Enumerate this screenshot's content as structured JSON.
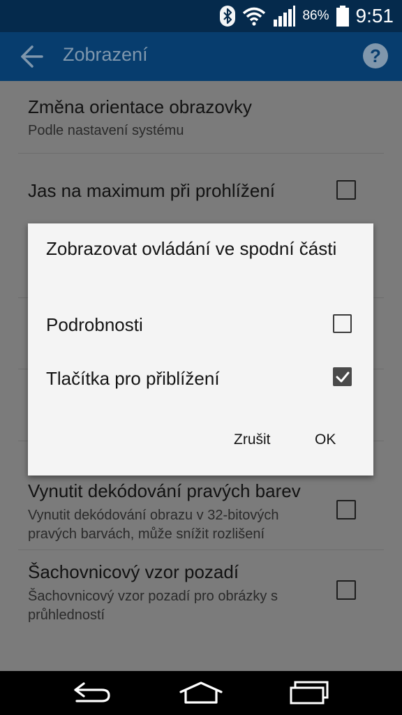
{
  "status_bar": {
    "battery_percent": "86%",
    "time": "9:51",
    "icons": [
      "bluetooth-icon",
      "wifi-icon",
      "signal-icon",
      "battery-icon"
    ]
  },
  "app_bar": {
    "title": "Zobrazení",
    "back_icon": "arrow-back-icon",
    "help_icon": "help-icon",
    "help_glyph": "?"
  },
  "preferences": [
    {
      "title": "Změna orientace obrazovky",
      "summary": "Podle nastavení systému"
    },
    {
      "title": "Jas na maximum při prohlížení",
      "checked": false
    },
    {
      "title": "Vynutit dekódování pravých barev",
      "summary_line1": "Vynutit dekódování obrazu v 32-bitových",
      "summary_line2": "pravých barvách, může snížit rozlišení",
      "checked": false
    },
    {
      "title": "Šachovnicový vzor pozadí",
      "summary_line1": "Šachovnicový vzor pozadí pro obrázky s",
      "summary_line2": "průhledností",
      "checked": false
    }
  ],
  "dialog": {
    "title": "Zobrazovat ovládání ve spodní části",
    "options": [
      {
        "label": "Podrobnosti",
        "checked": false
      },
      {
        "label": "Tlačítka pro přiblížení",
        "checked": true
      }
    ],
    "cancel_label": "Zrušit",
    "ok_label": "OK"
  },
  "nav_bar": {
    "icons": [
      "back-nav-icon",
      "home-nav-icon",
      "recents-nav-icon"
    ]
  },
  "colors": {
    "status_bar": "#052a4c",
    "app_bar": "#073d6e",
    "dim_background": "#7b7b7b",
    "dialog_background": "#f4f4f4"
  }
}
